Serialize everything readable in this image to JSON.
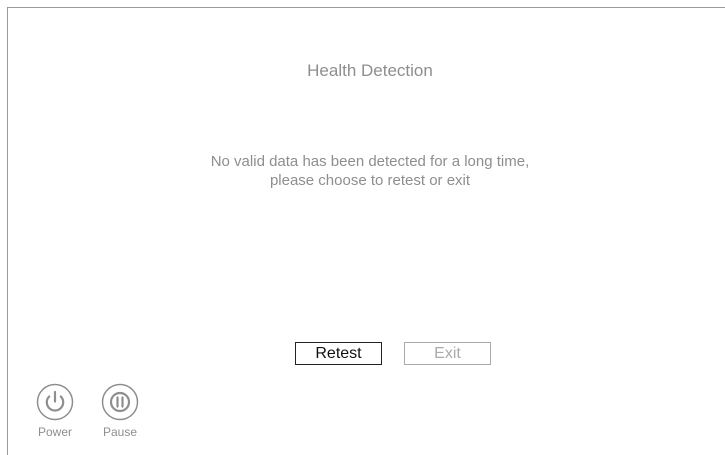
{
  "title": "Health Detection",
  "message": {
    "line1": "No valid data has been detected for a long time,",
    "line2": "please choose to retest or exit"
  },
  "buttons": {
    "retest": "Retest",
    "exit": "Exit"
  },
  "controls": {
    "power": {
      "label": "Power",
      "icon": "power-icon"
    },
    "pause": {
      "label": "Pause",
      "icon": "pause-icon"
    }
  },
  "colors": {
    "text": "#8e8e8e",
    "active_border": "#222222",
    "disabled_border": "#aaaaaa"
  }
}
